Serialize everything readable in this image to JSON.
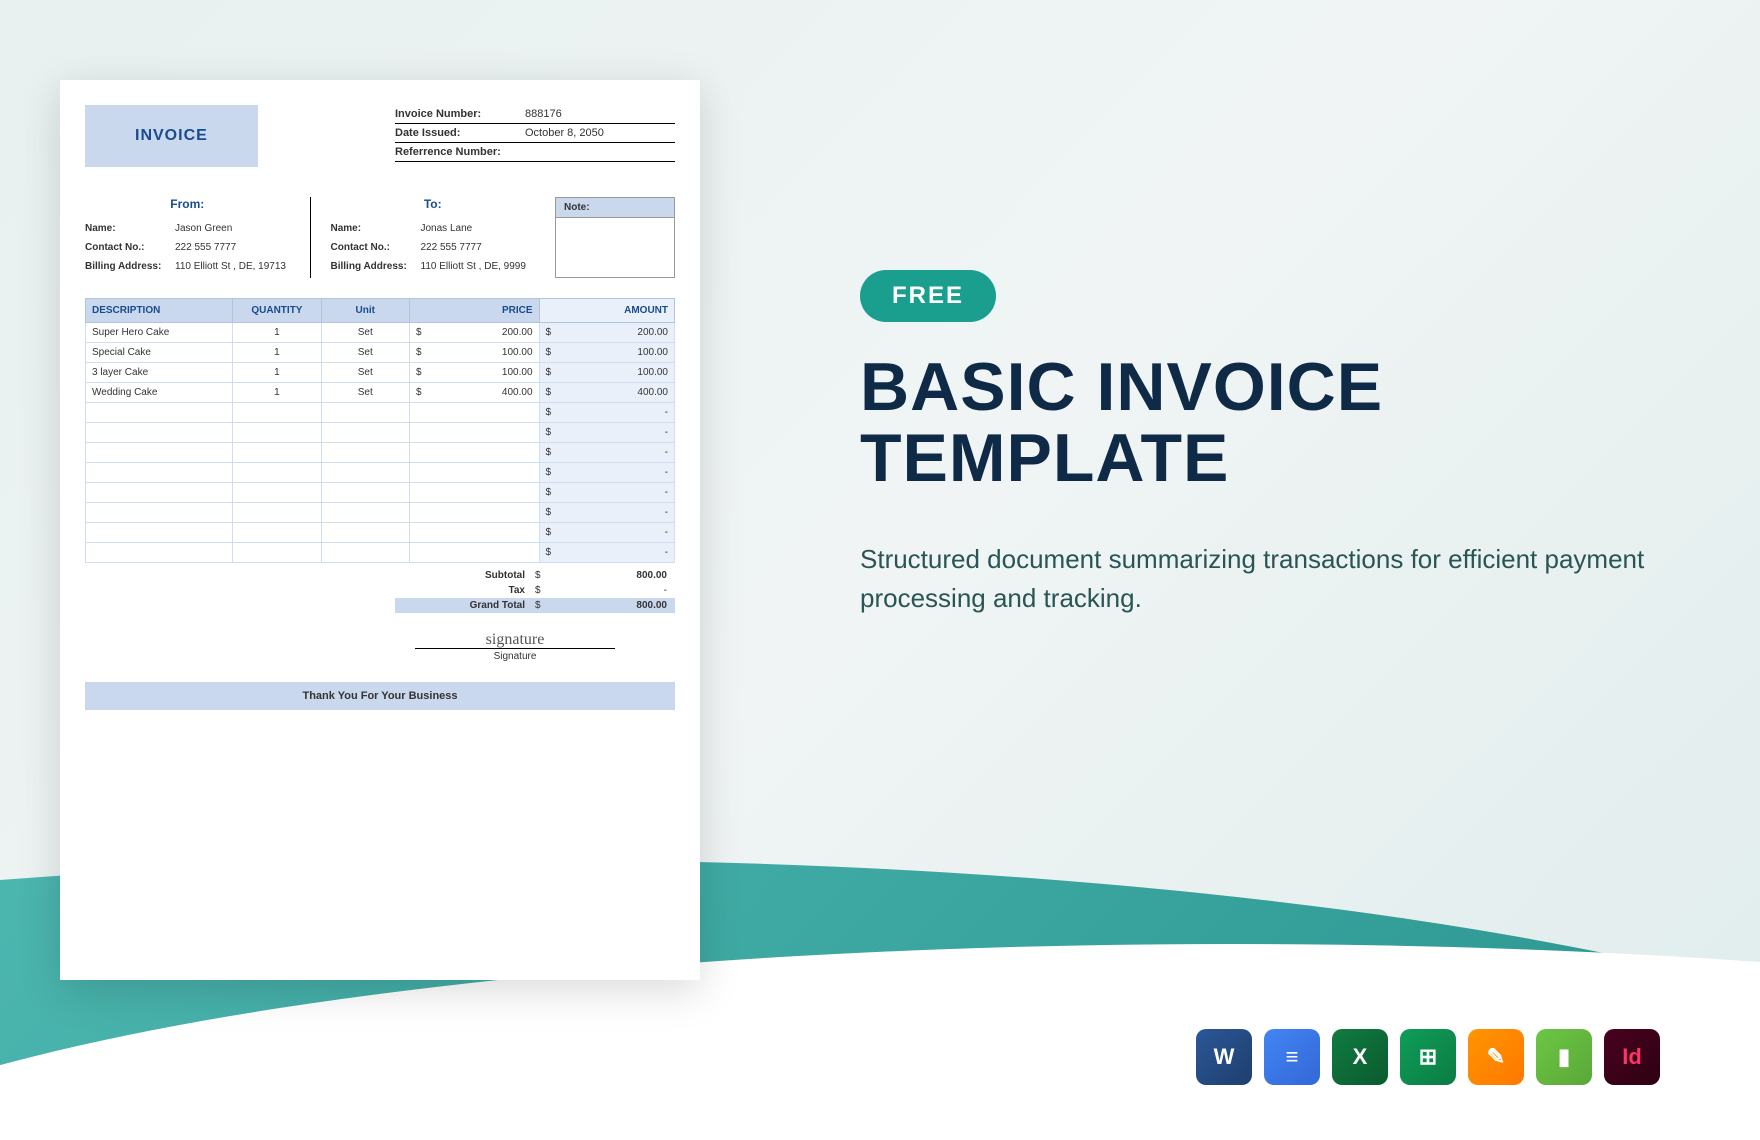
{
  "promo": {
    "badge": "FREE",
    "title": "BASIC INVOICE TEMPLATE",
    "description": "Structured document summarizing transactions for efficient payment processing and tracking."
  },
  "invoice": {
    "heading": "INVOICE",
    "meta": {
      "invoice_number_label": "Invoice Number:",
      "invoice_number": "888176",
      "date_issued_label": "Date Issued:",
      "date_issued": "October 8, 2050",
      "reference_label": "Referrence Number:",
      "reference": ""
    },
    "from": {
      "title": "From:",
      "name_label": "Name:",
      "name": "Jason Green",
      "contact_label": "Contact No.:",
      "contact": "222 555 7777",
      "address_label": "Billing Address:",
      "address": "110 Elliott St , DE, 19713"
    },
    "to": {
      "title": "To:",
      "name_label": "Name:",
      "name": "Jonas Lane",
      "contact_label": "Contact No.:",
      "contact": "222 555 7777",
      "address_label": "Billing Address:",
      "address": "110 Elliott St , DE, 9999"
    },
    "note_label": "Note:",
    "columns": {
      "description": "DESCRIPTION",
      "quantity": "QUANTITY",
      "unit": "Unit",
      "price": "PRICE",
      "amount": "AMOUNT"
    },
    "items": [
      {
        "desc": "Super Hero Cake",
        "qty": "1",
        "unit": "Set",
        "price": "200.00",
        "amount": "200.00"
      },
      {
        "desc": "Special Cake",
        "qty": "1",
        "unit": "Set",
        "price": "100.00",
        "amount": "100.00"
      },
      {
        "desc": "3 layer Cake",
        "qty": "1",
        "unit": "Set",
        "price": "100.00",
        "amount": "100.00"
      },
      {
        "desc": "Wedding Cake",
        "qty": "1",
        "unit": "Set",
        "price": "400.00",
        "amount": "400.00"
      }
    ],
    "empty_rows": 8,
    "totals": {
      "subtotal_label": "Subtotal",
      "subtotal": "800.00",
      "tax_label": "Tax",
      "tax": "-",
      "grand_label": "Grand Total",
      "grand": "800.00"
    },
    "signature_label": "Signature",
    "thanks": "Thank You For Your Business"
  },
  "apps": {
    "word": "W",
    "docs": "≡",
    "excel": "X",
    "sheets": "⊞",
    "pages": "✎",
    "numbers": "▮",
    "indesign": "Id"
  }
}
